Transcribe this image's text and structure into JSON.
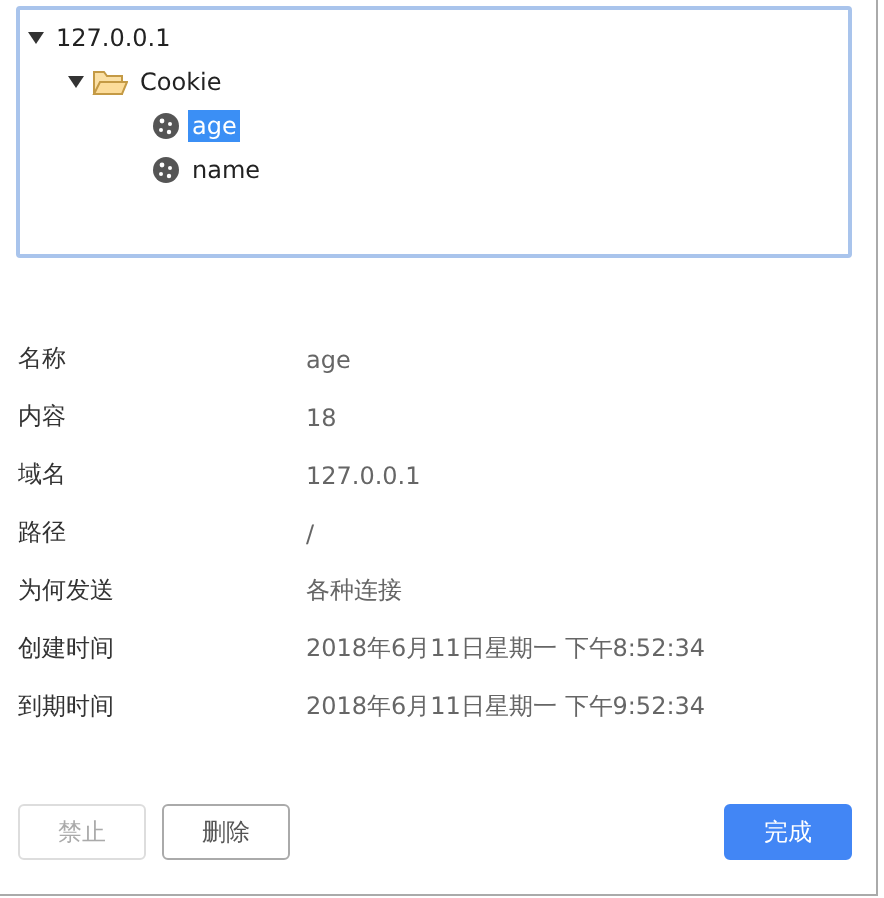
{
  "tree": [
    {
      "label": "127.0.0.1",
      "expanded": true,
      "selected": false,
      "children": [
        {
          "label": "Cookie",
          "kind": "folder",
          "expanded": true,
          "selected": false,
          "children": [
            {
              "label": "age",
              "kind": "cookie",
              "selected": true
            },
            {
              "label": "name",
              "kind": "cookie",
              "selected": false
            }
          ]
        }
      ]
    }
  ],
  "details": [
    {
      "label": "名称",
      "value": "age"
    },
    {
      "label": "内容",
      "value": "18"
    },
    {
      "label": "域名",
      "value": "127.0.0.1"
    },
    {
      "label": "路径",
      "value": "/"
    },
    {
      "label": "为何发送",
      "value": "各种连接"
    },
    {
      "label": "创建时间",
      "value": "2018年6月11日星期一 下午8:52:34"
    },
    {
      "label": "到期时间",
      "value": "2018年6月11日星期一 下午9:52:34"
    }
  ],
  "buttons": [
    {
      "label": "禁止",
      "kind": "secondary",
      "disabled": true
    },
    {
      "label": "删除",
      "kind": "secondary",
      "disabled": false
    },
    {
      "label": "完成",
      "kind": "primary",
      "disabled": false
    }
  ]
}
